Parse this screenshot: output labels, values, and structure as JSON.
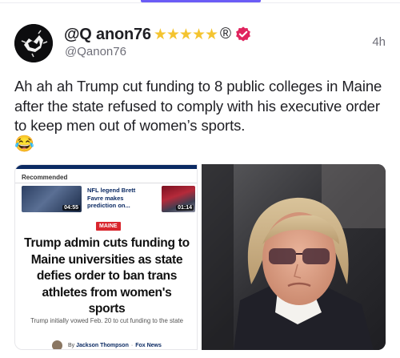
{
  "post": {
    "display_name": "@Q anon76",
    "stars": "★★★★★",
    "registered_mark": "®",
    "handle": "@Qanon76",
    "time": "4h",
    "text": "Ah ah ah Trump cut funding to 8 public colleges in Maine after the state refused to comply with his executive order to keep men out of women’s sports.",
    "emoji": "😂"
  },
  "article_card": {
    "section_label": "Recommended",
    "recommended_title": "NFL legend Brett Favre makes prediction on...",
    "video1_duration": "04:55",
    "video2_duration": "01:14",
    "tag": "MAINE",
    "headline": "Trump admin cuts funding to Maine universities as state defies order to ban trans athletes from women's sports",
    "subhead": "Trump initially vowed Feb. 20 to cut funding to the state",
    "byline_prefix": "By",
    "author": "Jackson Thompson",
    "outlet": "Fox News"
  },
  "colors": {
    "accent": "#6b5cf6",
    "star": "#f4c430",
    "verified": "#e0245e",
    "fox_navy": "#0b2a63",
    "tag_red": "#d9262e"
  },
  "icons": {
    "verified": "verified-badge-icon",
    "avatar": "avatar-image",
    "registered": "registered-mark"
  }
}
